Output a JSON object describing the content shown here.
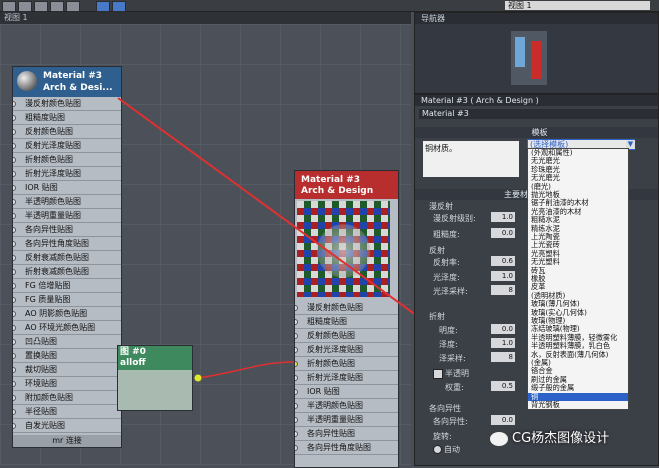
{
  "toolbar": {
    "view_select": "视图 1"
  },
  "viewport": {
    "tab_label": "视图 1"
  },
  "node1": {
    "title_line1": "Material #3",
    "title_line2": "Arch & Desi...",
    "slots": [
      "漫反射颜色贴图",
      "粗糙度贴图",
      "反射颜色贴图",
      "反射光泽度贴图",
      "折射颜色贴图",
      "折射光泽度贴图",
      "IOR 贴图",
      "半透明颜色贴图",
      "半透明重量贴图",
      "各向异性贴图",
      "各向异性角度贴图",
      "反射衰减颜色贴图",
      "折射衰减颜色贴图",
      "FG 倍增贴图",
      "FG 质量贴图",
      "AO 阴影颜色贴图",
      "AO 环境光颜色贴图",
      "凹凸贴图",
      "置换贴图",
      "裁切贴图",
      "环境贴图",
      "附加颜色贴图",
      "半径贴图",
      "自发光贴图"
    ],
    "footer": "mr 连接"
  },
  "node2": {
    "title_line1": "Material #3",
    "title_line2": "Arch & Design",
    "slots": [
      "漫反射颜色贴图",
      "粗糙度贴图",
      "反射颜色贴图",
      "反射光泽度贴图",
      "折射颜色贴图",
      "折射光泽度贴图",
      "IOR 贴图",
      "半透明颜色贴图",
      "半透明重量贴图",
      "各向异性贴图",
      "各向异性角度贴图"
    ]
  },
  "node3": {
    "label1": "图 #0",
    "label2": "alloff"
  },
  "nav": {
    "title": "导航器"
  },
  "mat": {
    "title": "Material #3 ( Arch & Design )",
    "name": "Material #3",
    "template_header": "模板",
    "template_desc": "铜材质。",
    "template_select": "(选择模板)",
    "main_header": "主要材",
    "diffuse_header": "漫反射",
    "diffuse_level_label": "漫反射级别:",
    "diffuse_level": "1.0",
    "roughness_label": "粗糙度:",
    "roughness": "0.0",
    "reflection_header": "反射",
    "reflectivity_label": "反射率:",
    "reflectivity": "0.6",
    "gloss_label": "光泽度:",
    "gloss": "1.0",
    "gloss_samples_label": "光泽采样:",
    "gloss_samples": "8",
    "refraction_header": "折射",
    "transparency_label": "明度:",
    "transparency": "0.0",
    "refr_gloss_label": "泽度:",
    "refr_gloss": "1.0",
    "refr_samples_label": "泽采样:",
    "refr_samples": "8",
    "translucency_label": "半透明",
    "weight_label": "权重:",
    "weight": "0.5",
    "aniso_header": "各向异性",
    "aniso_label": "各向异性:",
    "aniso": "0.0",
    "rotation_label": "旋转:",
    "auto_label": "自动"
  },
  "dropdown": {
    "items": [
      "(外观和属性)",
      "无光磨光",
      "珍珠磨光",
      "无光磨光",
      "(磨光)",
      "抛光地板",
      "锯子削油漆的木材",
      "光亮油漆的木材",
      "粗糙水泥",
      "精练水泥",
      "上光陶瓷",
      "上光瓷砖",
      "光亮塑料",
      "无光塑料",
      "砖瓦",
      "橡胶",
      "皮革",
      "(透明材质)",
      "玻璃(薄几何体)",
      "玻璃(实心几何体)",
      "玻璃(物理)",
      "冻结玻璃(物理)",
      "半透明塑料薄膜，轻微雾化",
      "半透明塑料薄膜，乳白色",
      "水，反射表面(薄几何体)",
      "(金属)",
      "铬合金",
      "刷过的金属",
      "缎子般的金属",
      "铜",
      "背光钢板"
    ],
    "selected_index": 29
  },
  "watermark": "CG杨杰图像设计",
  "colors": {
    "node_header": "#2f5f8f",
    "connector": "#e03030",
    "selection": "#2b61c8"
  }
}
